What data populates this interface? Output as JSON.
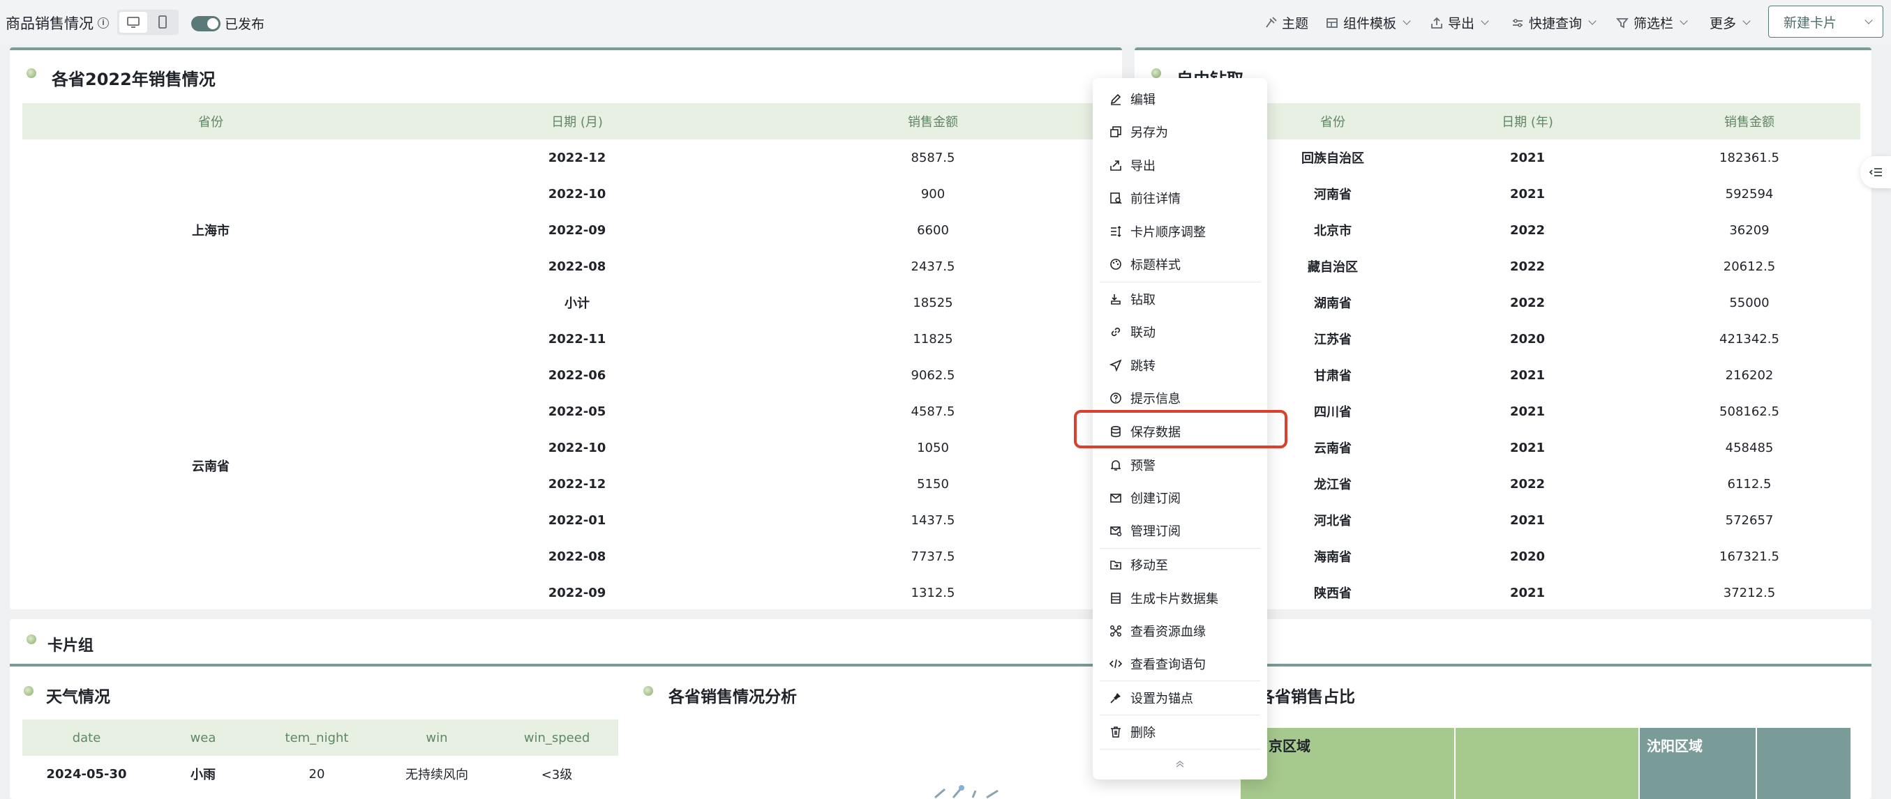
{
  "header": {
    "title": "商品销售情况",
    "published_label": "已发布",
    "tools": [
      {
        "key": "theme",
        "label": "主题",
        "dropdown": false
      },
      {
        "key": "templates",
        "label": "组件模板",
        "dropdown": true
      },
      {
        "key": "export",
        "label": "导出",
        "dropdown": true
      },
      {
        "key": "quick_query",
        "label": "快捷查询",
        "dropdown": true
      },
      {
        "key": "filter_bar",
        "label": "筛选栏",
        "dropdown": true
      },
      {
        "key": "more",
        "label": "更多",
        "dropdown": true
      }
    ],
    "new_card_label": "新建卡片"
  },
  "card1": {
    "title": "各省2022年销售情况",
    "headers": [
      "省份",
      "日期 (月)",
      "销售金额"
    ],
    "groups": [
      {
        "province": "上海市",
        "rows": [
          [
            "2022-12",
            "8587.5"
          ],
          [
            "2022-10",
            "900"
          ],
          [
            "2022-09",
            "6600"
          ],
          [
            "2022-08",
            "2437.5"
          ],
          [
            "小计",
            "18525"
          ]
        ]
      },
      {
        "province": "云南省",
        "rows": [
          [
            "2022-11",
            "11825"
          ],
          [
            "2022-06",
            "9062.5"
          ],
          [
            "2022-05",
            "4587.5"
          ],
          [
            "2022-10",
            "1050"
          ],
          [
            "2022-12",
            "5150"
          ],
          [
            "2022-01",
            "1437.5"
          ],
          [
            "2022-08",
            "7737.5"
          ],
          [
            "2022-09",
            "1312.5"
          ]
        ]
      }
    ]
  },
  "card2": {
    "title": "自由钻取",
    "headers": [
      "省份",
      "日期 (年)",
      "销售金额"
    ],
    "rows": [
      [
        "回族自治区",
        "2021",
        "182361.5"
      ],
      [
        "河南省",
        "2021",
        "592594"
      ],
      [
        "北京市",
        "2022",
        "36209"
      ],
      [
        "藏自治区",
        "2022",
        "20612.5"
      ],
      [
        "湖南省",
        "2022",
        "55000"
      ],
      [
        "江苏省",
        "2020",
        "421342.5"
      ],
      [
        "甘肃省",
        "2021",
        "216202"
      ],
      [
        "四川省",
        "2021",
        "508162.5"
      ],
      [
        "云南省",
        "2021",
        "458485"
      ],
      [
        "龙江省",
        "2022",
        "6112.5"
      ],
      [
        "河北省",
        "2021",
        "572657"
      ],
      [
        "海南省",
        "2020",
        "167321.5"
      ],
      [
        "陕西省",
        "2021",
        "37212.5"
      ]
    ]
  },
  "card_group": {
    "title": "卡片组"
  },
  "weather": {
    "title": "天气情况",
    "headers": [
      "date",
      "wea",
      "tem_night",
      "win",
      "win_speed"
    ],
    "rows": [
      [
        "2024-05-30",
        "小雨",
        "20",
        "无持续风向",
        "<3级"
      ]
    ]
  },
  "analysis": {
    "title": "各省销售情况分析"
  },
  "share": {
    "title": "各省销售占比",
    "treemap_labels": [
      "京区域",
      "沈阳区域"
    ]
  },
  "menu": {
    "items": [
      {
        "icon": "edit-icon",
        "label": "编辑"
      },
      {
        "icon": "save-as-icon",
        "label": "另存为"
      },
      {
        "icon": "export-icon",
        "label": "导出"
      },
      {
        "icon": "details-icon",
        "label": "前往详情"
      },
      {
        "icon": "reorder-icon",
        "label": "卡片顺序调整"
      },
      {
        "icon": "palette-icon",
        "label": "标题样式"
      },
      {
        "icon": "drill-icon",
        "label": "钻取"
      },
      {
        "icon": "link-icon",
        "label": "联动"
      },
      {
        "icon": "jump-icon",
        "label": "跳转"
      },
      {
        "icon": "help-icon",
        "label": "提示信息"
      },
      {
        "icon": "database-icon",
        "label": "保存数据"
      },
      {
        "icon": "bell-icon",
        "label": "预警"
      },
      {
        "icon": "mail-icon",
        "label": "创建订阅"
      },
      {
        "icon": "mail-settings-icon",
        "label": "管理订阅"
      },
      {
        "icon": "move-icon",
        "label": "移动至"
      },
      {
        "icon": "dataset-icon",
        "label": "生成卡片数据集"
      },
      {
        "icon": "lineage-icon",
        "label": "查看资源血缘"
      },
      {
        "icon": "code-icon",
        "label": "查看查询语句"
      },
      {
        "icon": "pin-icon",
        "label": "设置为锚点"
      },
      {
        "icon": "trash-icon",
        "label": "删除"
      }
    ]
  },
  "colors": {
    "accent": "#5a7a77",
    "header_bg": "#e8f0e3",
    "highlight": "#d9412e"
  }
}
